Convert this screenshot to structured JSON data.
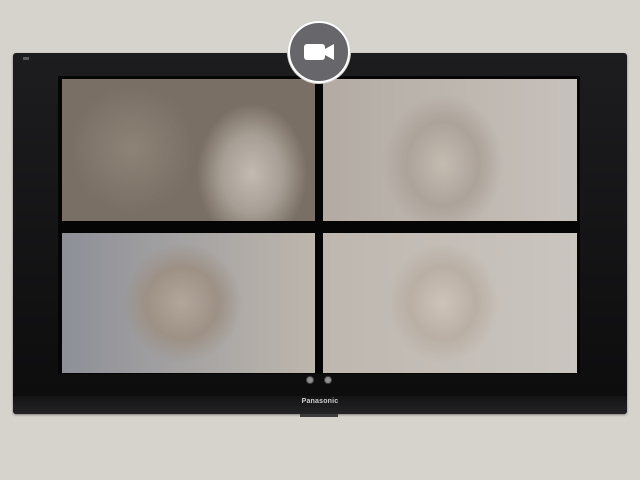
{
  "tv": {
    "brand": "Panasonic"
  },
  "badge": {
    "icon": "video-camera-icon",
    "colors": {
      "background": "#66666b",
      "border": "#ffffff",
      "icon": "#ffffff"
    }
  },
  "tiles": [
    {
      "position": "top-left"
    },
    {
      "position": "top-right"
    },
    {
      "position": "bottom-left"
    },
    {
      "position": "bottom-right"
    }
  ],
  "indicator_dots": 2
}
